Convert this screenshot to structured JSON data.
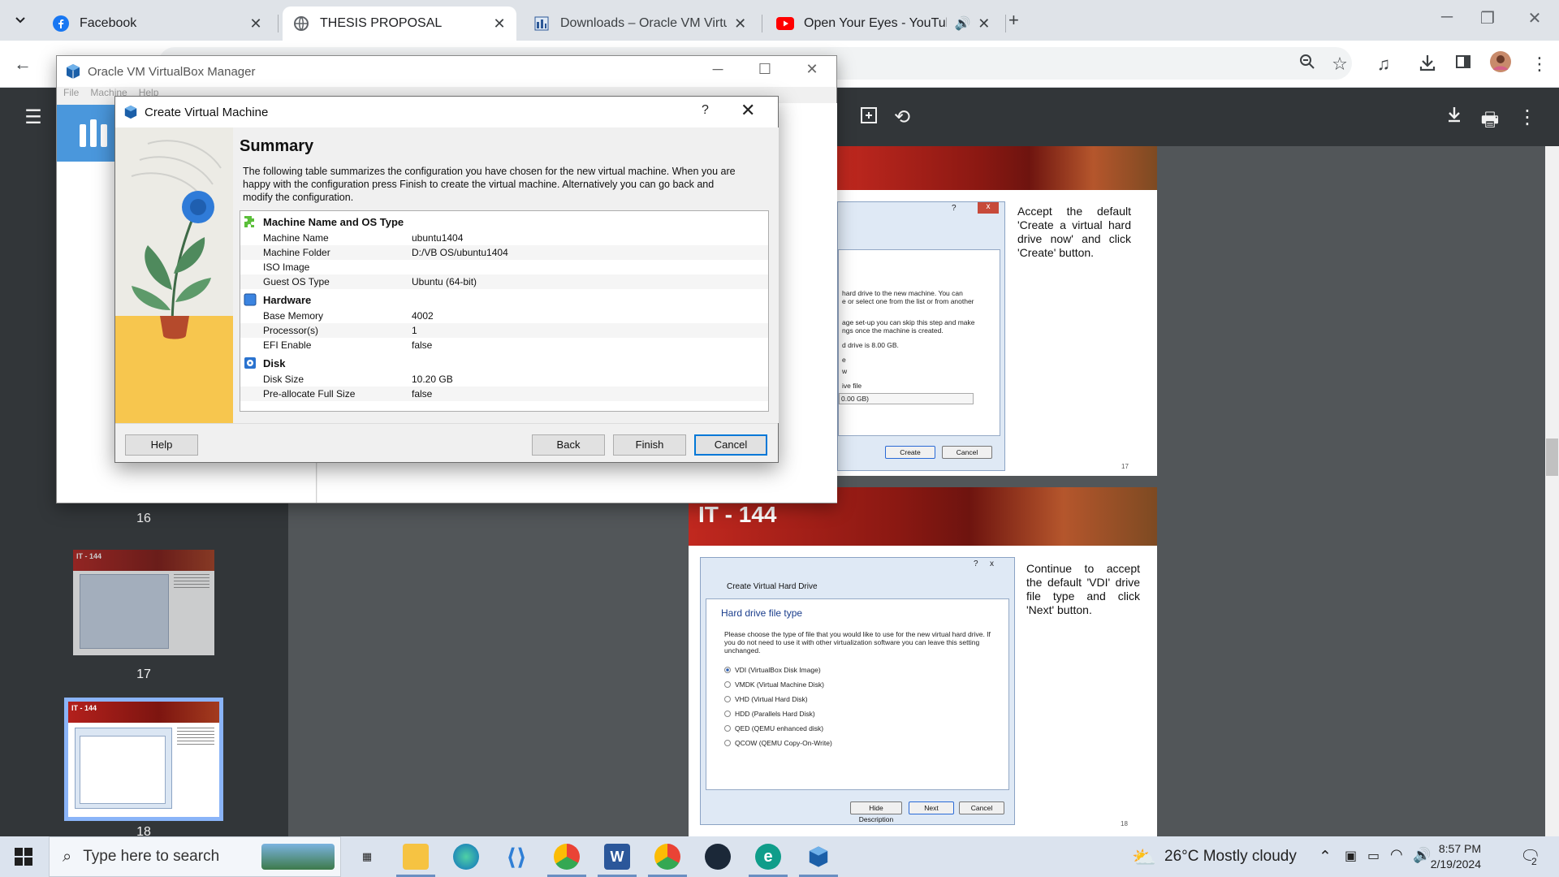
{
  "browser": {
    "tabs": [
      {
        "title": "Facebook",
        "icon": "facebook-icon"
      },
      {
        "title": "THESIS PROPOSAL",
        "icon": "globe-icon"
      },
      {
        "title": "Downloads – Oracle VM Virtual",
        "icon": "word-doc-icon"
      },
      {
        "title": "Open Your Eyes - YouTube",
        "icon": "youtube-icon"
      }
    ],
    "close_glyph": "✕",
    "new_tab_glyph": "+"
  },
  "pdf": {
    "thumbnails": [
      {
        "num": "16",
        "banner": ""
      },
      {
        "num": "17",
        "banner": "IT - 144"
      },
      {
        "num": "18",
        "banner": "IT - 144"
      }
    ],
    "page17": {
      "text": "Accept the default 'Create a virtual hard drive now' and click 'Create' button.",
      "shot_lines": [
        "hard drive to the new machine. You can",
        "e or select one from the list or from another",
        "age set-up you can skip this step and make",
        "ngs once the machine is created.",
        "d drive is 8.00 GB.",
        "e",
        "w",
        "ive file"
      ],
      "dropdown_value": "0.00 GB)",
      "create_label": "Create",
      "cancel_label": "Cancel",
      "page_number": "17"
    },
    "page18": {
      "banner_title": "IT - 144",
      "text": "Continue to accept the default 'VDI' drive file type and click 'Next' button.",
      "dialog_title": "Create Virtual Hard Drive",
      "heading": "Hard drive file type",
      "description": "Please choose the type of file that you would like to use for the new virtual hard drive. If you do not need to use it with other virtualization software you can leave this setting unchanged.",
      "options": [
        {
          "label": "VDI (VirtualBox Disk Image)",
          "selected": true
        },
        {
          "label": "VMDK (Virtual Machine Disk)",
          "selected": false
        },
        {
          "label": "VHD (Virtual Hard Disk)",
          "selected": false
        },
        {
          "label": "HDD (Parallels Hard Disk)",
          "selected": false
        },
        {
          "label": "QED (QEMU enhanced disk)",
          "selected": false
        },
        {
          "label": "QCOW (QEMU Copy-On-Write)",
          "selected": false
        }
      ],
      "hide_description_label": "Hide Description",
      "next_label": "Next",
      "cancel_label": "Cancel",
      "page_number": "18"
    }
  },
  "vbox_manager": {
    "title": "Oracle VM VirtualBox Manager",
    "menu": [
      "File",
      "Machine",
      "Help"
    ]
  },
  "dialog": {
    "title": "Create Virtual Machine",
    "help_glyph": "?",
    "heading": "Summary",
    "description": "The following table summarizes the configuration you have chosen for the new virtual machine. When you are happy with the configuration press Finish to create the virtual machine. Alternatively you can go back and modify the configuration.",
    "sections": [
      {
        "title": "Machine Name and OS Type",
        "icon": "puzzle-icon",
        "rows": [
          {
            "key": "Machine Name",
            "value": "ubuntu1404"
          },
          {
            "key": "Machine Folder",
            "value": "D:/VB OS/ubuntu1404"
          },
          {
            "key": "ISO Image",
            "value": ""
          },
          {
            "key": "Guest OS Type",
            "value": "Ubuntu (64-bit)"
          }
        ]
      },
      {
        "title": "Hardware",
        "icon": "chip-icon",
        "rows": [
          {
            "key": "Base Memory",
            "value": "4002"
          },
          {
            "key": "Processor(s)",
            "value": "1"
          },
          {
            "key": "EFI Enable",
            "value": "false"
          }
        ]
      },
      {
        "title": "Disk",
        "icon": "disk-icon",
        "rows": [
          {
            "key": "Disk Size",
            "value": "10.20 GB"
          },
          {
            "key": "Pre-allocate Full Size",
            "value": "false"
          }
        ]
      }
    ],
    "buttons": {
      "help": "Help",
      "back": "Back",
      "finish": "Finish",
      "cancel": "Cancel"
    }
  },
  "taskbar": {
    "search_placeholder": "Type here to search",
    "weather": "26°C  Mostly cloudy",
    "time": "8:57 PM",
    "date": "2/19/2024",
    "notifications": "2"
  }
}
